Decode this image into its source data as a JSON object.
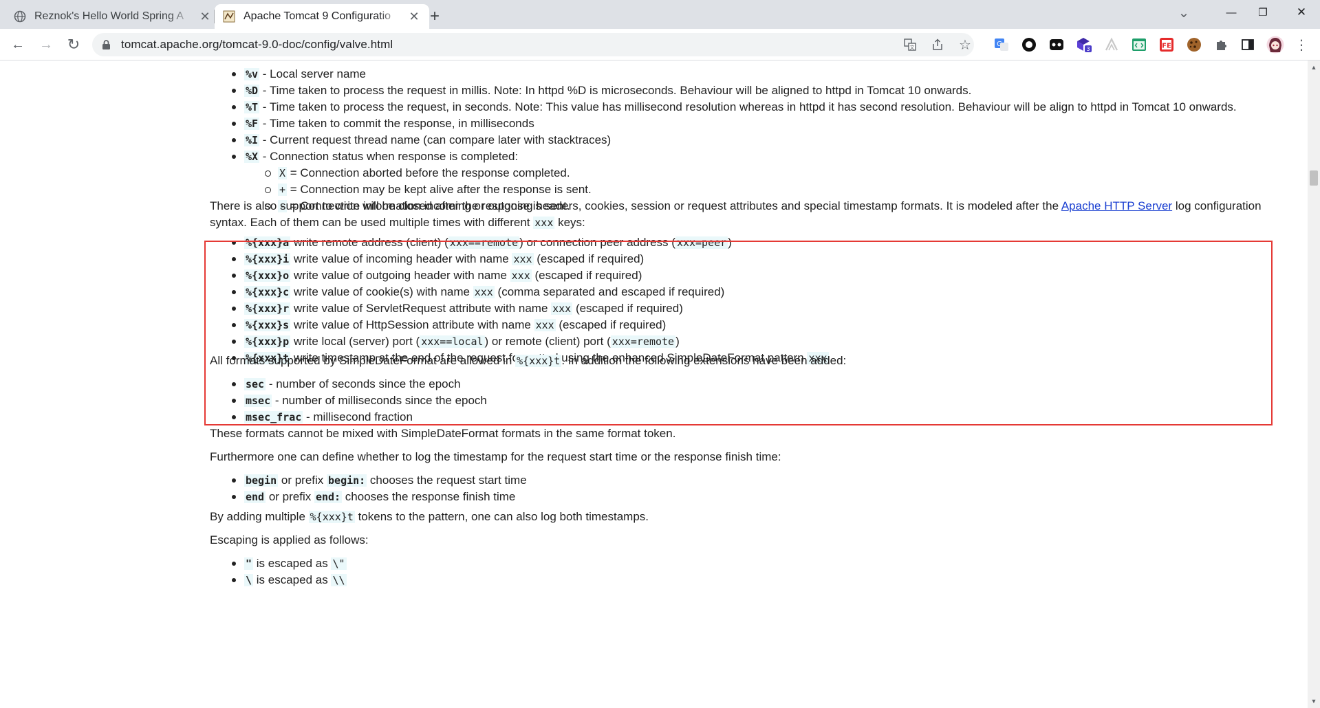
{
  "tabs": [
    {
      "title": "Reznok's Hello World Spring A",
      "close": "✕"
    },
    {
      "title": "Apache Tomcat 9 Configuratio",
      "close": "✕"
    }
  ],
  "new_tab": "+",
  "window_controls": {
    "tab_search": "⌄",
    "minimize": "—",
    "restore": "❐",
    "close": "✕"
  },
  "toolbar": {
    "back": "←",
    "forward": "→",
    "reload": "↻",
    "url": "tomcat.apache.org/tomcat-9.0-doc/config/valve.html",
    "extension_badge": "3"
  },
  "content": {
    "top_list": [
      {
        "code": "%v",
        "text": " - Local server name"
      },
      {
        "code": "%D",
        "text": " - Time taken to process the request in millis. Note: In httpd %D is microseconds. Behaviour will be aligned to httpd in Tomcat 10 onwards."
      },
      {
        "code": "%T",
        "text": " - Time taken to process the request, in seconds. Note: This value has millisecond resolution whereas in httpd it has second resolution. Behaviour will be align to httpd in Tomcat 10 onwards."
      },
      {
        "code": "%F",
        "text": " - Time taken to commit the response, in milliseconds"
      },
      {
        "code": "%I",
        "text": " - Current request thread name (can compare later with stacktraces)"
      },
      {
        "code": "%X",
        "text": " - Connection status when response is completed:"
      }
    ],
    "x_status_list": [
      {
        "code": "X",
        "text": " = Connection aborted before the response completed."
      },
      {
        "code": "+",
        "text": " = Connection may be kept alive after the response is sent."
      },
      {
        "code": "-",
        "text": " = Connection will be closed after the response is sent."
      }
    ],
    "support_para": {
      "before_link": "There is also support to write information incoming or outgoing headers, cookies, session or request attributes and special timestamp formats. It is modeled after the ",
      "link": "Apache HTTP Server",
      "after_link": " log configuration syntax. Each of them can be used multiple times with different ",
      "code": "xxx",
      "end": " keys:"
    },
    "xxx_list": [
      {
        "code": "%{xxx}a",
        "parts": [
          " write remote address (client) (",
          {
            "c": "xxx==remote"
          },
          ") or connection peer address (",
          {
            "c": "xxx=peer"
          },
          ")"
        ]
      },
      {
        "code": "%{xxx}i",
        "parts": [
          " write value of incoming header with name ",
          {
            "c": "xxx"
          },
          " (escaped if required)"
        ]
      },
      {
        "code": "%{xxx}o",
        "parts": [
          " write value of outgoing header with name ",
          {
            "c": "xxx"
          },
          " (escaped if required)"
        ]
      },
      {
        "code": "%{xxx}c",
        "parts": [
          " write value of cookie(s) with name ",
          {
            "c": "xxx"
          },
          " (comma separated and escaped if required)"
        ]
      },
      {
        "code": "%{xxx}r",
        "parts": [
          " write value of ServletRequest attribute with name ",
          {
            "c": "xxx"
          },
          " (escaped if required)"
        ]
      },
      {
        "code": "%{xxx}s",
        "parts": [
          " write value of HttpSession attribute with name ",
          {
            "c": "xxx"
          },
          " (escaped if required)"
        ]
      },
      {
        "code": "%{xxx}p",
        "parts": [
          " write local (server) port (",
          {
            "c": "xxx==local"
          },
          ") or remote (client) port (",
          {
            "c": "xxx=remote"
          },
          ")"
        ]
      },
      {
        "code": "%{xxx}t",
        "parts": [
          " write timestamp at the end of the request formatted using the enhanced SimpleDateFormat pattern ",
          {
            "c": "xxx"
          }
        ]
      }
    ],
    "formats_para": {
      "before": "All formats supported by SimpleDateFormat are allowed in ",
      "code": "%{xxx}t",
      "after": ". In addition the following extensions have been added:"
    },
    "ext_list": [
      {
        "code": "sec",
        "text": " - number of seconds since the epoch"
      },
      {
        "code": "msec",
        "text": " - number of milliseconds since the epoch"
      },
      {
        "code": "msec_frac",
        "text": " - millisecond fraction"
      }
    ],
    "mixed_para": "These formats cannot be mixed with SimpleDateFormat formats in the same format token.",
    "furthermore_para": "Furthermore one can define whether to log the timestamp for the request start time or the response finish time:",
    "begin_end_list": [
      {
        "code": "begin",
        "mid": " or prefix ",
        "code2": "begin:",
        "text": " chooses the request start time"
      },
      {
        "code": "end",
        "mid": " or prefix ",
        "code2": "end:",
        "text": " chooses the response finish time"
      }
    ],
    "adding_para": {
      "before": "By adding multiple ",
      "code": "%{xxx}t",
      "after": " tokens to the pattern, one can also log both timestamps."
    },
    "escaping_para": "Escaping is applied as follows:",
    "escape_list": [
      {
        "code": "\"",
        "text": " is escaped as ",
        "code2": "\\\""
      },
      {
        "code": "\\",
        "text": " is escaped as ",
        "code2": "\\\\"
      }
    ]
  }
}
